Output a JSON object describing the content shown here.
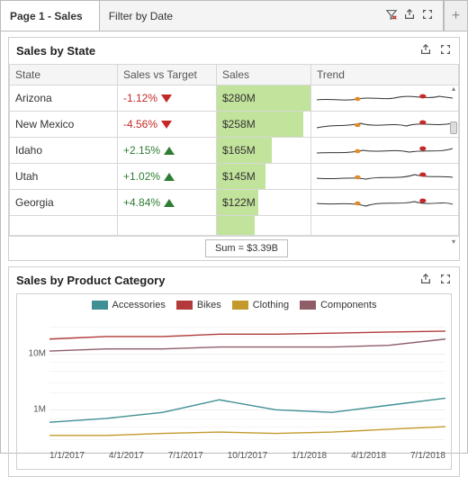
{
  "tabs": {
    "page_title": "Page 1 - Sales",
    "filter_title": "Filter by Date",
    "add_label": "+"
  },
  "panel_state": {
    "title": "Sales by State",
    "columns": {
      "state": "State",
      "vs": "Sales vs Target",
      "sales": "Sales",
      "trend": "Trend"
    },
    "rows": [
      {
        "state": "Arizona",
        "vs": "-1.12%",
        "dir": "down",
        "sales": "$280M"
      },
      {
        "state": "New Mexico",
        "vs": "-4.56%",
        "dir": "down",
        "sales": "$258M"
      },
      {
        "state": "Idaho",
        "vs": "+2.15%",
        "dir": "up",
        "sales": "$165M"
      },
      {
        "state": "Utah",
        "vs": "+1.02%",
        "dir": "up",
        "sales": "$145M"
      },
      {
        "state": "Georgia",
        "vs": "+4.84%",
        "dir": "up",
        "sales": "$122M"
      }
    ],
    "cut_row": {
      "state_hint": "",
      "vs_hint": ""
    },
    "sum_label": "Sum = $3.39B"
  },
  "panel_chart": {
    "title": "Sales by Product Category",
    "legend": [
      {
        "name": "Accessories",
        "color": "#3f8f94"
      },
      {
        "name": "Bikes",
        "color": "#b23a3a"
      },
      {
        "name": "Clothing",
        "color": "#c49a2d"
      },
      {
        "name": "Components",
        "color": "#8f5d68"
      }
    ],
    "yticks": [
      "10M",
      "1M"
    ],
    "xticks": [
      "1/1/2017",
      "4/1/2017",
      "7/1/2017",
      "10/1/2017",
      "1/1/2018",
      "4/1/2018",
      "7/1/2018"
    ]
  },
  "chart_data": [
    {
      "type": "table",
      "title": "Sales by State",
      "columns": [
        "State",
        "Sales vs Target (%)",
        "Sales ($M)"
      ],
      "rows": [
        [
          "Arizona",
          -1.12,
          280
        ],
        [
          "New Mexico",
          -4.56,
          258
        ],
        [
          "Idaho",
          2.15,
          165
        ],
        [
          "Utah",
          1.02,
          145
        ],
        [
          "Georgia",
          4.84,
          122
        ]
      ],
      "aggregate": {
        "label": "Sum",
        "value_usd_billion": 3.39
      },
      "trend_sparklines": "per-row mini line chart with two highlighted points (orange early, red late)"
    },
    {
      "type": "line",
      "title": "Sales by Product Category",
      "xlabel": "",
      "ylabel": "",
      "yscale": "log",
      "ylim": [
        200000,
        50000000
      ],
      "yticks": [
        1000000,
        10000000
      ],
      "x": [
        "2017-01-01",
        "2017-04-01",
        "2017-07-01",
        "2017-10-01",
        "2018-01-01",
        "2018-04-01",
        "2018-07-01",
        "2018-09-30"
      ],
      "series": [
        {
          "name": "Accessories",
          "color": "#3f8f94",
          "values": [
            600000,
            700000,
            900000,
            1500000,
            1000000,
            900000,
            1200000,
            1600000
          ]
        },
        {
          "name": "Bikes",
          "color": "#b23a3a",
          "values": [
            18000000,
            20000000,
            20000000,
            22000000,
            22000000,
            23000000,
            24000000,
            25000000
          ]
        },
        {
          "name": "Clothing",
          "color": "#c49a2d",
          "values": [
            350000,
            350000,
            380000,
            400000,
            380000,
            400000,
            450000,
            500000
          ]
        },
        {
          "name": "Components",
          "color": "#8f5d68",
          "values": [
            11000000,
            12000000,
            12000000,
            13000000,
            13000000,
            13000000,
            14000000,
            18000000
          ]
        }
      ],
      "legend_position": "top"
    }
  ]
}
